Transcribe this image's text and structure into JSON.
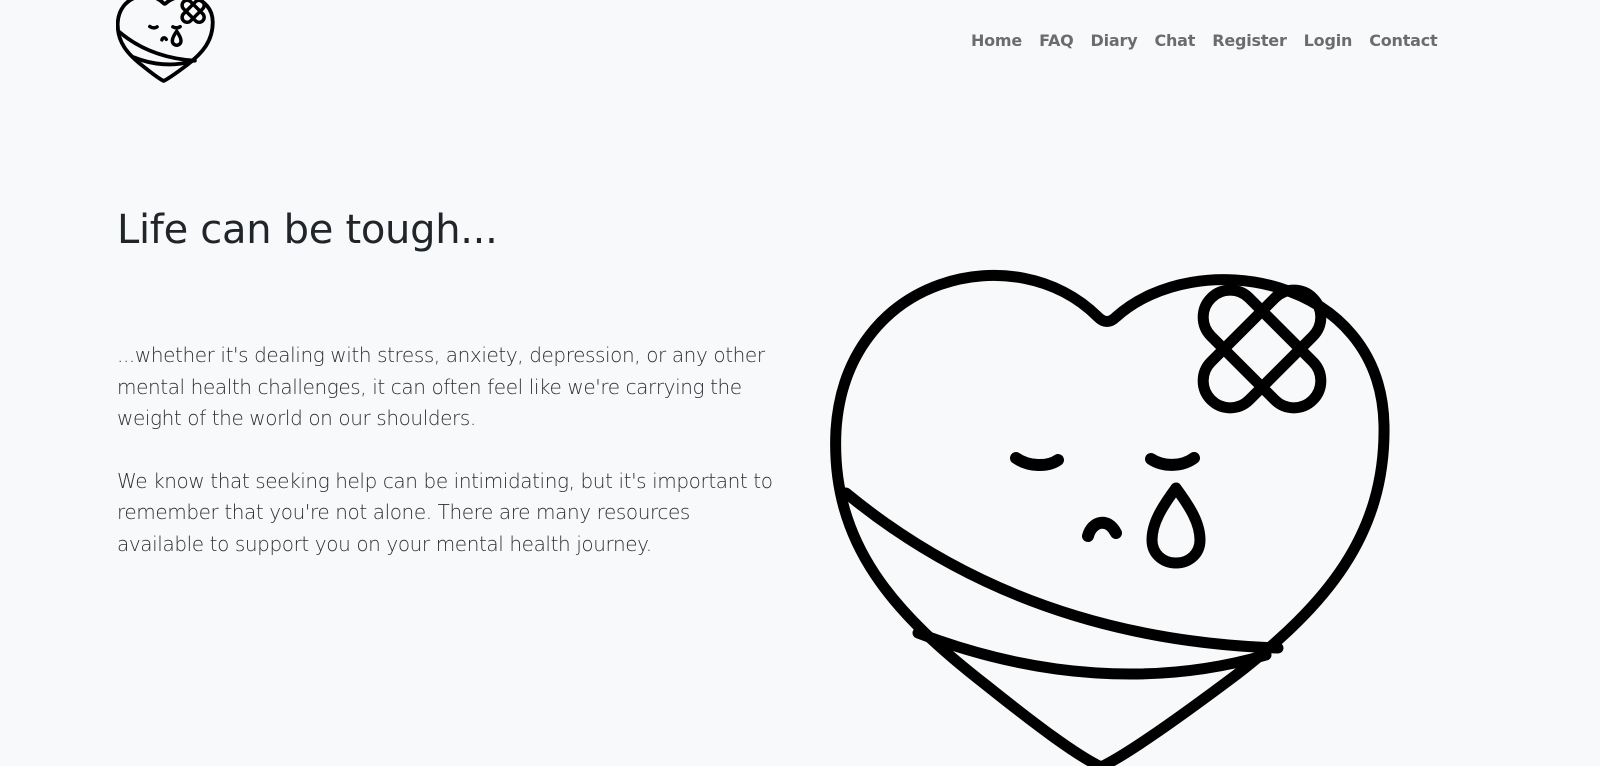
{
  "brand": {
    "logo_icon": "crying-bandaged-heart-icon"
  },
  "nav": {
    "items": [
      {
        "label": "Home"
      },
      {
        "label": "FAQ"
      },
      {
        "label": "Diary"
      },
      {
        "label": "Chat"
      },
      {
        "label": "Register"
      },
      {
        "label": "Login"
      },
      {
        "label": "Contact"
      }
    ]
  },
  "hero": {
    "title": "Life can be tough...",
    "paragraphs": [
      "...whether it's dealing with stress, anxiety, depression, or any other mental health challenges, it can often feel like we're carrying the weight of the world on our shoulders.",
      "We know that seeking help can be intimidating, but it's important to remember that you're not alone. There are many resources available to support you on your mental health journey."
    ],
    "illustration_icon": "crying-bandaged-heart-icon"
  },
  "colors": {
    "background": "#f8f9fa",
    "heading": "#212529",
    "nav_text": "#6c6c6c",
    "line_art": "#000000"
  }
}
